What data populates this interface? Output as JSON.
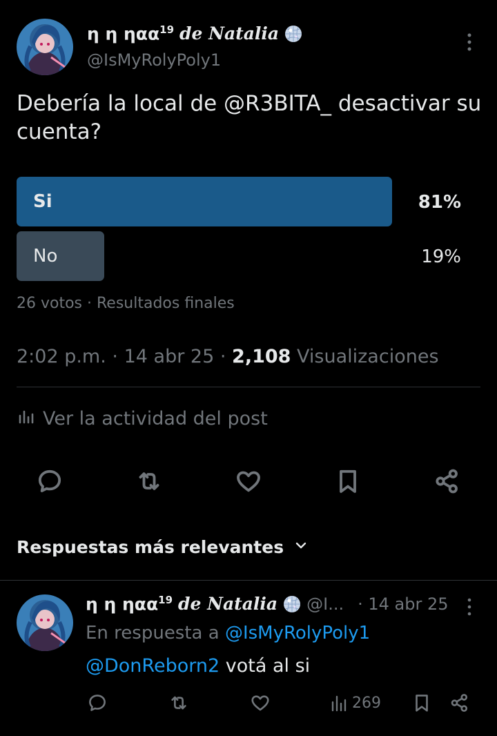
{
  "post": {
    "author": {
      "name_prefix": "η η ηαα",
      "name_sup": "19",
      "name_script": "de Natalia",
      "handle": "@IsMyRolyPoly1",
      "emoji_icon": "disco-ball-icon"
    },
    "text": "Debería la local de @R3BITA_ desactivar su cuenta?",
    "poll": {
      "options": [
        {
          "label": "Si",
          "percent_text": "81%",
          "percent": 81,
          "color": "#1a5a8a"
        },
        {
          "label": "No",
          "percent_text": "19%",
          "percent": 19,
          "color": "#3a4a58"
        }
      ],
      "meta": "26 votos · Resultados finales"
    },
    "time": "2:02 p.m.",
    "date": "14 abr 25",
    "views_count": "2,108",
    "views_label": "Visualizaciones",
    "activity_label": "Ver la actividad del post",
    "actions": [
      "reply-icon",
      "repost-icon",
      "like-icon",
      "bookmark-icon",
      "share-icon"
    ]
  },
  "replies_section": {
    "title": "Respuestas más relevantes"
  },
  "reply": {
    "author": {
      "name_prefix": "η η ηαα",
      "name_sup": "19",
      "name_script": "de Natalia",
      "handle_truncated": "@I...",
      "date": "· 14 abr 25"
    },
    "in_reply_prefix": "En respuesta a",
    "in_reply_handle": "@IsMyRolyPoly1",
    "mention": "@DonReborn2",
    "text": "votá al si",
    "views": "269"
  },
  "colors": {
    "background": "#000000",
    "text": "#e7e9ea",
    "muted": "#71767b",
    "link": "#1d9bf0",
    "divider": "#2f3336"
  }
}
